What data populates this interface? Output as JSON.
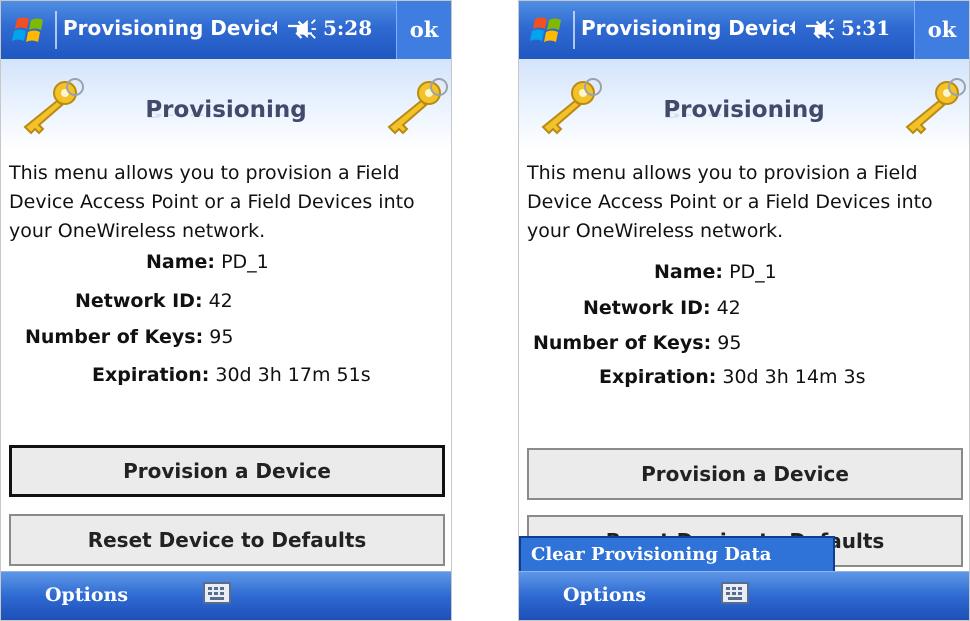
{
  "screens": [
    {
      "title": "Provisioning Devic€",
      "clock": "5:28",
      "ok_label": "ok",
      "banner_title": "Provisioning",
      "description": "This menu allows you to provision a Field Device Access Point or a Field Devices into your OneWireless network.",
      "fields": [
        {
          "label": "Name:",
          "value": "PD_1"
        },
        {
          "label": "Network ID:",
          "value": "42"
        },
        {
          "label": "Number of Keys:",
          "value": "95"
        },
        {
          "label": "Expiration:",
          "value": "30d 3h 17m 51s"
        }
      ],
      "buttons": {
        "provision": "Provision a Device",
        "reset": "Reset Device to Defaults"
      },
      "menu": {
        "options": "Options"
      }
    },
    {
      "title": "Provisioning Devic€",
      "clock": "5:31",
      "ok_label": "ok",
      "banner_title": "Provisioning",
      "description": "This menu allows you to provision a Field Device Access Point or a Field Devices into your OneWireless network.",
      "fields": [
        {
          "label": "Name:",
          "value": "PD_1"
        },
        {
          "label": "Network ID:",
          "value": "42"
        },
        {
          "label": "Number of Keys:",
          "value": "95"
        },
        {
          "label": "Expiration:",
          "value": "30d 3h 14m 3s"
        }
      ],
      "buttons": {
        "provision": "Provision a Device",
        "reset": "Reset Device to Defaults"
      },
      "menu": {
        "options": "Options"
      },
      "popup_item": "Clear Provisioning Data"
    }
  ],
  "icons": [
    "windows-start-icon",
    "connectivity-icon",
    "speaker-icon",
    "key-icon",
    "keyboard-icon"
  ]
}
